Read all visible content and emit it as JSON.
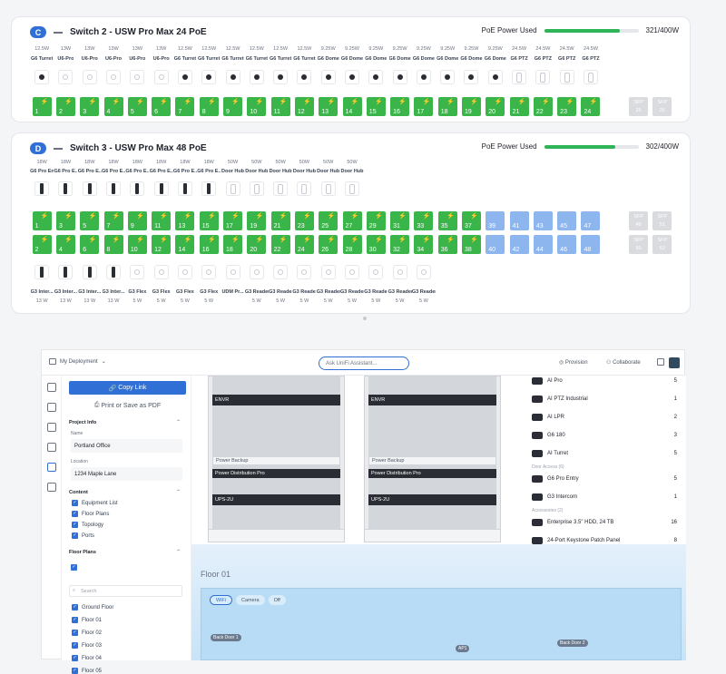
{
  "switch_c": {
    "badge": "C",
    "title": "Switch 2 - USW Pro Max 24 PoE",
    "poe_label": "PoE Power Used",
    "poe_value": "321/400W",
    "poe_fraction": 0.8025,
    "watts": [
      "12.5W",
      "13W",
      "13W",
      "13W",
      "13W",
      "13W",
      "12.5W",
      "12.5W",
      "12.5W",
      "12.5W",
      "12.5W",
      "12.5W",
      "9.25W",
      "9.25W",
      "9.25W",
      "9.25W",
      "9.25W",
      "9.25W",
      "9.25W",
      "9.25W",
      "24.5W",
      "24.5W",
      "24.5W",
      "24.5W"
    ],
    "names": [
      "G6 Turret",
      "U6-Pro",
      "U6-Pro",
      "U6-Pro",
      "U6-Pro",
      "U6-Pro",
      "G6 Turret",
      "G6 Turret",
      "G6 Turret",
      "G6 Turret",
      "G6 Turret",
      "G6 Turret",
      "G6 Dome",
      "G6 Dome",
      "G6 Dome",
      "G6 Dome",
      "G6 Dome",
      "G6 Dome",
      "G6 Dome",
      "G6 Dome",
      "G6 PTZ",
      "G6 PTZ",
      "G6 PTZ",
      "G6 PTZ"
    ],
    "ports": [
      "1",
      "2",
      "3",
      "4",
      "5",
      "6",
      "7",
      "8",
      "9",
      "10",
      "11",
      "12",
      "13",
      "14",
      "15",
      "16",
      "17",
      "18",
      "19",
      "20",
      "21",
      "22",
      "23",
      "24"
    ],
    "sfp": [
      [
        "SFP",
        "25"
      ],
      [
        "SFP",
        "26"
      ]
    ]
  },
  "switch_d": {
    "badge": "D",
    "title": "Switch 3 - USW Pro Max 48 PoE",
    "poe_label": "PoE Power Used",
    "poe_value": "302/400W",
    "poe_fraction": 0.755,
    "watts": [
      "18W",
      "18W",
      "18W",
      "18W",
      "18W",
      "18W",
      "18W",
      "18W",
      "50W",
      "50W",
      "50W",
      "50W",
      "50W",
      "50W"
    ],
    "names": [
      "G6 Pro Ent",
      "G6 Pro E...",
      "G6 Pro E...",
      "G6 Pro E...",
      "G6 Pro E...",
      "G6 Pro E...",
      "G6 Pro E...",
      "G6 Pro E...",
      "Door Hub",
      "Door Hub",
      "Door Hub",
      "Door Hub",
      "Door Hub",
      "Door Hub"
    ],
    "ports_odd": [
      "1",
      "3",
      "5",
      "7",
      "9",
      "11",
      "13",
      "15",
      "17",
      "19",
      "21",
      "23",
      "25",
      "27",
      "29",
      "31",
      "33",
      "35",
      "37",
      "39",
      "41",
      "43",
      "45",
      "47"
    ],
    "ports_even": [
      "2",
      "4",
      "6",
      "8",
      "10",
      "12",
      "14",
      "16",
      "18",
      "20",
      "22",
      "24",
      "26",
      "28",
      "30",
      "32",
      "34",
      "36",
      "38",
      "40",
      "42",
      "44",
      "46",
      "48"
    ],
    "sfp_top": [
      [
        "SFP",
        "49"
      ],
      [
        "SFP",
        "51"
      ]
    ],
    "sfp_bot": [
      [
        "SFP",
        "50"
      ],
      [
        "SFP",
        "52"
      ]
    ],
    "bottom_names": [
      "G3 Inter...",
      "G3 Inter...",
      "G3 Inter...",
      "G3 Inter...",
      "G3 Flex",
      "G3 Flex",
      "G3 Flex",
      "G3 Flex",
      "UDM Pr...",
      "G3 Reader",
      "G3 Reader",
      "G3 Reader",
      "G3 Reader",
      "G3 Reader",
      "G3 Reader",
      "G3 Reader",
      "G3 Reader"
    ],
    "bottom_watts": [
      "13 W",
      "13 W",
      "13 W",
      "13 W",
      "5 W",
      "5 W",
      "5 W",
      "5 W",
      "",
      "5 W",
      "5 W",
      "5 W",
      "5 W",
      "5 W",
      "5 W",
      "5 W",
      "5 W"
    ]
  },
  "topbar": {
    "deployment": "My Deployment",
    "ask_placeholder": "Ask UniFi Assistant...",
    "provision": "Provision",
    "collaborate": "Collaborate"
  },
  "panel": {
    "copy_link": "Copy Link",
    "print_save": "Print or Save as PDF",
    "project_info": "Project Info",
    "name_label": "Name",
    "name_value": "Portland Office",
    "location_label": "Location",
    "location_value": "1234 Maple Lane",
    "content": "Content",
    "content_items": [
      "Equipment List",
      "Floor Plans",
      "Topology",
      "Ports"
    ],
    "floor_plans": "Floor Plans",
    "search_placeholder": "Search",
    "floors": [
      "Ground Floor",
      "Floor 01",
      "Floor 02",
      "Floor 03",
      "Floor 04",
      "Floor 05"
    ]
  },
  "racks": [
    {
      "units": [
        "ENVR",
        "Power Backup",
        "Power Distribution Pro",
        "UPS-2U"
      ]
    },
    {
      "units": [
        "ENVR",
        "Power Backup",
        "Power Distribution Pro",
        "UPS-2U"
      ]
    }
  ],
  "equipment": {
    "items_top": [
      {
        "name": "AI Pro",
        "qty": "5"
      },
      {
        "name": "AI PTZ Industrial",
        "qty": "1"
      },
      {
        "name": "AI LPR",
        "qty": "2"
      },
      {
        "name": "G6 180",
        "qty": "3"
      },
      {
        "name": "AI Turret",
        "qty": "5"
      }
    ],
    "door_access": "Door Access (6)",
    "items_door": [
      {
        "name": "G6 Pro Entry",
        "qty": "5"
      },
      {
        "name": "G3 Intercom",
        "qty": "1"
      }
    ],
    "accessories": "Accessories (2)",
    "items_acc": [
      {
        "name": "Enterprise 3.5\" HDD, 24 TB",
        "qty": "16"
      },
      {
        "name": "24-Port Keystone Patch Panel",
        "qty": "8"
      }
    ]
  },
  "floor": {
    "title": "Floor 01",
    "layers": [
      "WiFi",
      "Camera",
      "Off"
    ],
    "labels": [
      "Back Door 1",
      "Back Door 2",
      "AP1"
    ]
  },
  "colors": {
    "accent": "#2f6fd6",
    "poe_green": "#39b54a",
    "inactive_blue": "#8db5ee"
  }
}
